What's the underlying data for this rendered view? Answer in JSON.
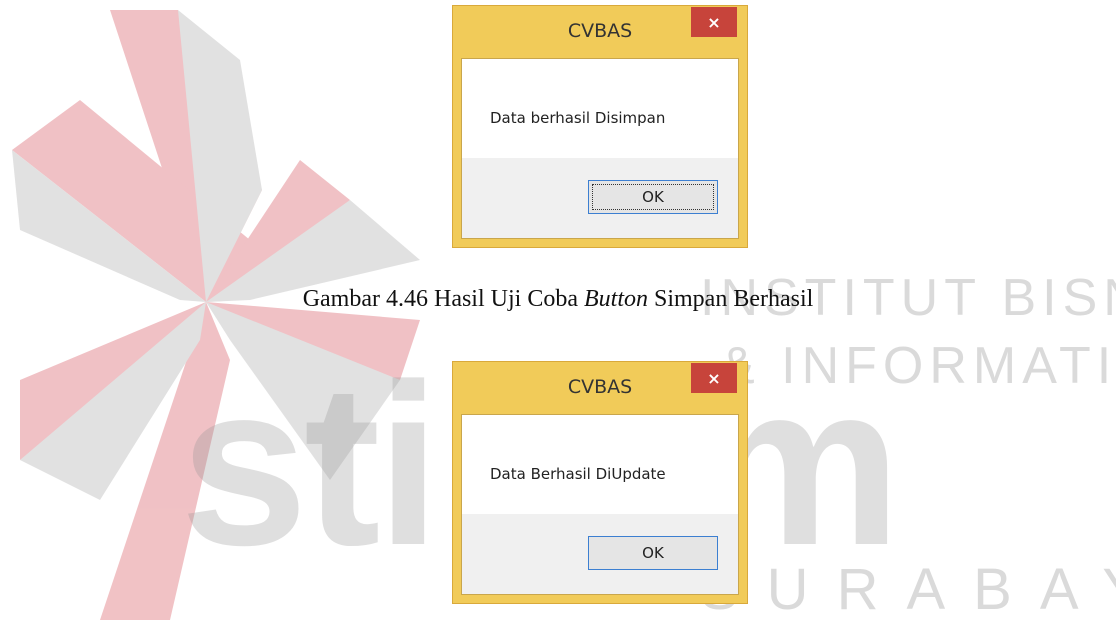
{
  "watermark": {
    "line1": "INSTITUT BISNIS",
    "line2": "& INFORMATIKA",
    "brand": "stikom",
    "city": "SURABAYA"
  },
  "dialogs": [
    {
      "title": "CVBAS",
      "message": "Data berhasil Disimpan",
      "ok_label": "OK",
      "close_glyph": "×"
    },
    {
      "title": "CVBAS",
      "message": "Data Berhasil DiUpdate",
      "ok_label": "OK",
      "close_glyph": "×"
    }
  ],
  "caption": {
    "prefix": "Gambar 4.46 Hasil Uji Coba ",
    "italic": "Button",
    "suffix": " Simpan Berhasil"
  },
  "colors": {
    "title_bar": "#f1cb59",
    "close_button": "#c7443b",
    "watermark_red": "#e58f96",
    "watermark_gray": "#c9c9c9"
  }
}
